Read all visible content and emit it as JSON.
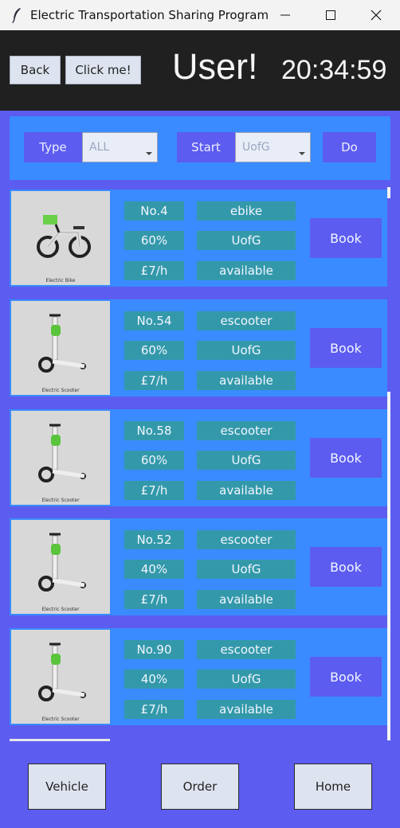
{
  "window": {
    "title": "Electric Transportation Sharing Program"
  },
  "header": {
    "back_label": "Back",
    "click_label": "Click me!",
    "user_label": "User!",
    "clock": "20:34:59"
  },
  "filters": {
    "type_label": "Type",
    "type_value": "ALL",
    "start_label": "Start",
    "start_value": "UofG",
    "do_label": "Do"
  },
  "vehicles": [
    {
      "no": "No.4",
      "type": "ebike",
      "battery": "60%",
      "location": "UofG",
      "price": "£7/h",
      "status": "available",
      "caption": "Electric Bike",
      "book": "Book"
    },
    {
      "no": "No.54",
      "type": "escooter",
      "battery": "60%",
      "location": "UofG",
      "price": "£7/h",
      "status": "available",
      "caption": "Electric Scooter",
      "book": "Book"
    },
    {
      "no": "No.58",
      "type": "escooter",
      "battery": "60%",
      "location": "UofG",
      "price": "£7/h",
      "status": "available",
      "caption": "Electric Scooter",
      "book": "Book"
    },
    {
      "no": "No.52",
      "type": "escooter",
      "battery": "40%",
      "location": "UofG",
      "price": "£7/h",
      "status": "available",
      "caption": "Electric Scooter",
      "book": "Book"
    },
    {
      "no": "No.90",
      "type": "escooter",
      "battery": "40%",
      "location": "UofG",
      "price": "£7/h",
      "status": "available",
      "caption": "Electric Scooter",
      "book": "Book"
    }
  ],
  "nav": {
    "vehicle": "Vehicle",
    "order": "Order",
    "home": "Home"
  },
  "colors": {
    "background": "#5c5cf0",
    "panel": "#3a8bff",
    "cell": "#3399aa",
    "header": "#202020"
  }
}
